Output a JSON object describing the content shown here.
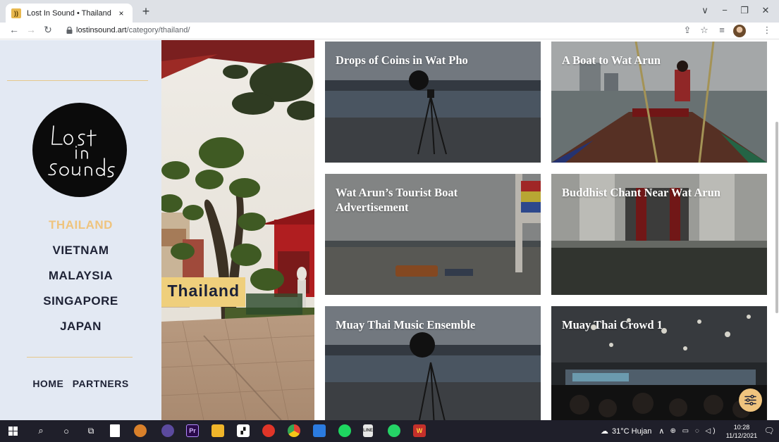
{
  "browser": {
    "tab_title": "Lost In Sound • Thailand",
    "tab_close": "×",
    "new_tab": "+",
    "url_domain": "lostinsound.art",
    "url_path": "/category/thailand/",
    "window_controls": [
      "∨",
      "−",
      "❐",
      "✕"
    ]
  },
  "sidebar": {
    "logo_lines": [
      "Lost",
      "in",
      "Sounds"
    ],
    "nav": [
      {
        "label": "THAILAND",
        "active": true
      },
      {
        "label": "VIETNAM",
        "active": false
      },
      {
        "label": "MALAYSIA",
        "active": false
      },
      {
        "label": "SINGAPORE",
        "active": false
      },
      {
        "label": "JAPAN",
        "active": false
      }
    ],
    "bottom_nav": [
      "HOME",
      "PARTNERS"
    ]
  },
  "hero": {
    "label": "Thailand"
  },
  "cards": [
    {
      "title": "Drops of Coins in Wat Pho",
      "scene": "river-tripod"
    },
    {
      "title": "A Boat to Wat Arun",
      "scene": "boat"
    },
    {
      "title": "Wat Arun’s Tourist Boat Advertisement",
      "scene": "river-boat"
    },
    {
      "title": "Buddhist Chant Near Wat Arun",
      "scene": "temple"
    },
    {
      "title": "Muay Thai Music Ensemble",
      "scene": "river-tripod"
    },
    {
      "title": "Muay Thai Crowd 1",
      "scene": "crowd"
    }
  ],
  "taskbar": {
    "weather": "31°C  Hujan",
    "time": "10:28",
    "date": "11/12/2021"
  },
  "colors": {
    "sidebar_bg": "#e3e9f3",
    "accent_gold": "#efc47e",
    "nav_text": "#1e2235"
  }
}
